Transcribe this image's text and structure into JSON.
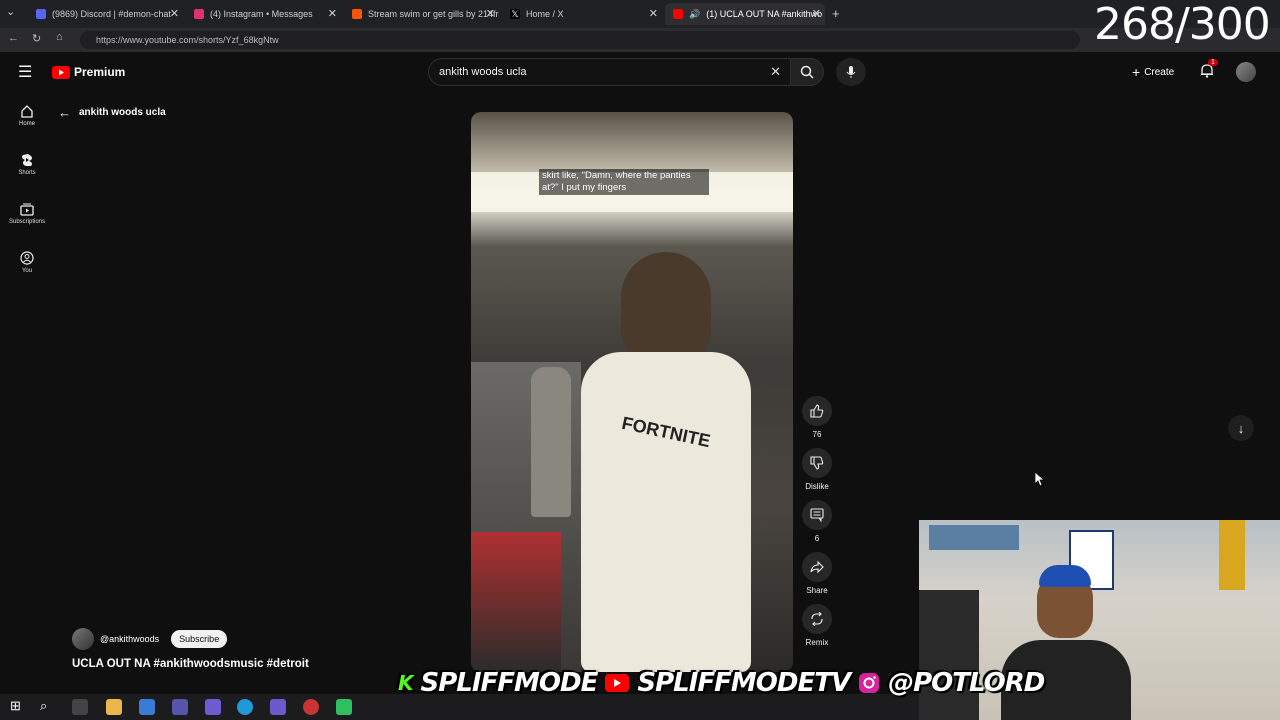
{
  "browser": {
    "tabs": [
      {
        "label": "(9869) Discord | #demon-chat",
        "color": "#5865f2"
      },
      {
        "label": "(4) Instagram • Messages",
        "color": "#e1306c"
      },
      {
        "label": "Stream swim or get gills by 214fre",
        "color": "#ff5500"
      },
      {
        "label": "Home / X",
        "color": "#ffffff"
      },
      {
        "label": "(1) UCLA OUT NA #ankithwo",
        "color": "#ff0000"
      }
    ],
    "url": "https://www.youtube.com/shorts/Yzf_68kgNtw"
  },
  "counter": "268/300",
  "youtube": {
    "logo_text": "Premium",
    "search_value": "ankith woods ucla",
    "create_label": "Create",
    "notification_count": "1",
    "back_label": "ankith woods ucla",
    "sidebar": [
      {
        "label": "Home",
        "icon": "home-icon"
      },
      {
        "label": "Shorts",
        "icon": "shorts-icon"
      },
      {
        "label": "Subscriptions",
        "icon": "subscriptions-icon"
      },
      {
        "label": "You",
        "icon": "you-icon"
      }
    ]
  },
  "video": {
    "caption": "skirt like, \"Damn, where the panties at?\" I put my fingers",
    "shirt_text": "FORTNITE",
    "likes": "76",
    "dislike_label": "Dislike",
    "comments": "6",
    "share_label": "Share",
    "remix_label": "Remix"
  },
  "channel": {
    "handle": "@ankithwoods",
    "subscribe_label": "Subscribe",
    "title": "UCLA OUT NA #ankithwoodsmusic #detroit"
  },
  "overlay": {
    "kick": "SPLIFFMODE",
    "youtube": "SPLIFFMODETV",
    "instagram": "@POTLORD"
  },
  "colors": {
    "yt_red": "#ff0000",
    "bg": "#0f0f0f"
  }
}
